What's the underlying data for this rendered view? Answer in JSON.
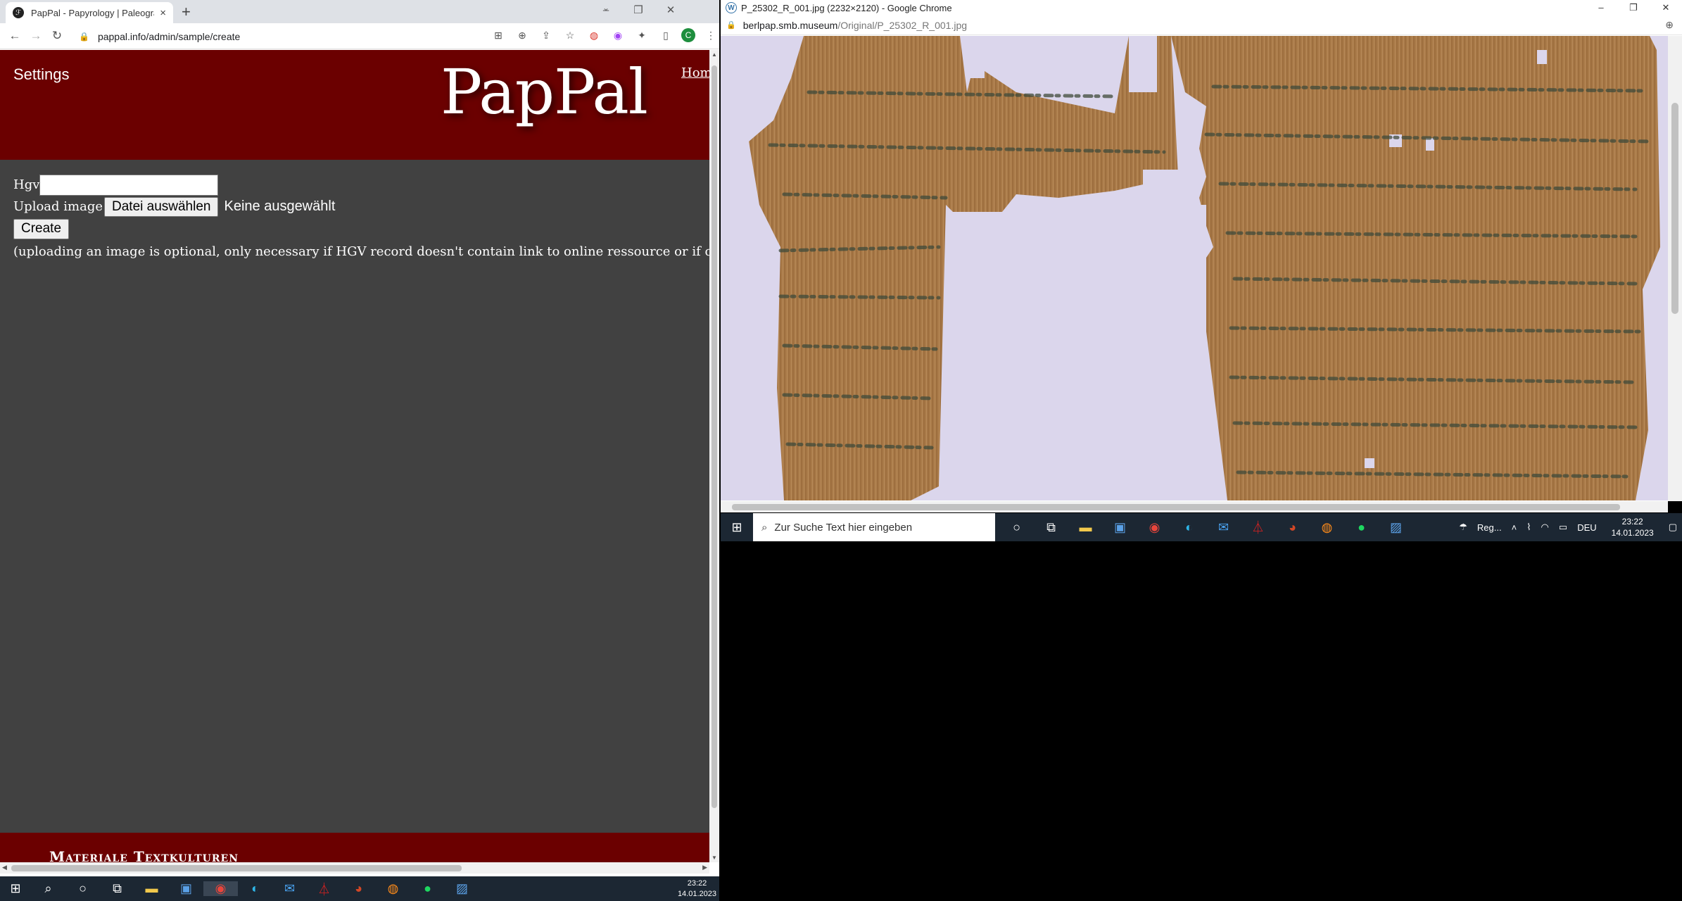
{
  "left_browser": {
    "tab_title": "PapPal - Papyrology | Paleograph",
    "url": "pappal.info/admin/sample/create",
    "new_tab": "+",
    "close_tab": "×"
  },
  "site": {
    "settings_label": "Settings",
    "logo": "PapPal",
    "home_label": "Hom",
    "footer_title": "Materiale Textkulturen"
  },
  "form": {
    "hgv_label": "Hgv",
    "hgv_value": "",
    "upload_label": "Upload image",
    "file_button": "Datei auswählen",
    "file_status": "Keine ausgewählt",
    "create_button": "Create",
    "note": "(uploading an image is optional, only necessary if HGV record doesn't contain link to online ressource or if online arc"
  },
  "right_browser": {
    "window_title": "P_25302_R_001.jpg (2232×2120) - Google Chrome",
    "url_host": "berlpap.smb.museum",
    "url_path": "/Original/P_25302_R_001.jpg"
  },
  "mini_taskbar": {
    "search_placeholder": "Zur Suche Text hier eingeben",
    "weather": "Reg...",
    "language": "DEU",
    "time": "23:22",
    "date": "14.01.2023"
  },
  "taskbar": {
    "time": "23:22",
    "date": "14.01.2023"
  },
  "colors": {
    "header_red": "#6b0000",
    "page_gray": "#414141",
    "papyrus": "#a87b4a",
    "viewer_bg": "#dbd6ec"
  }
}
